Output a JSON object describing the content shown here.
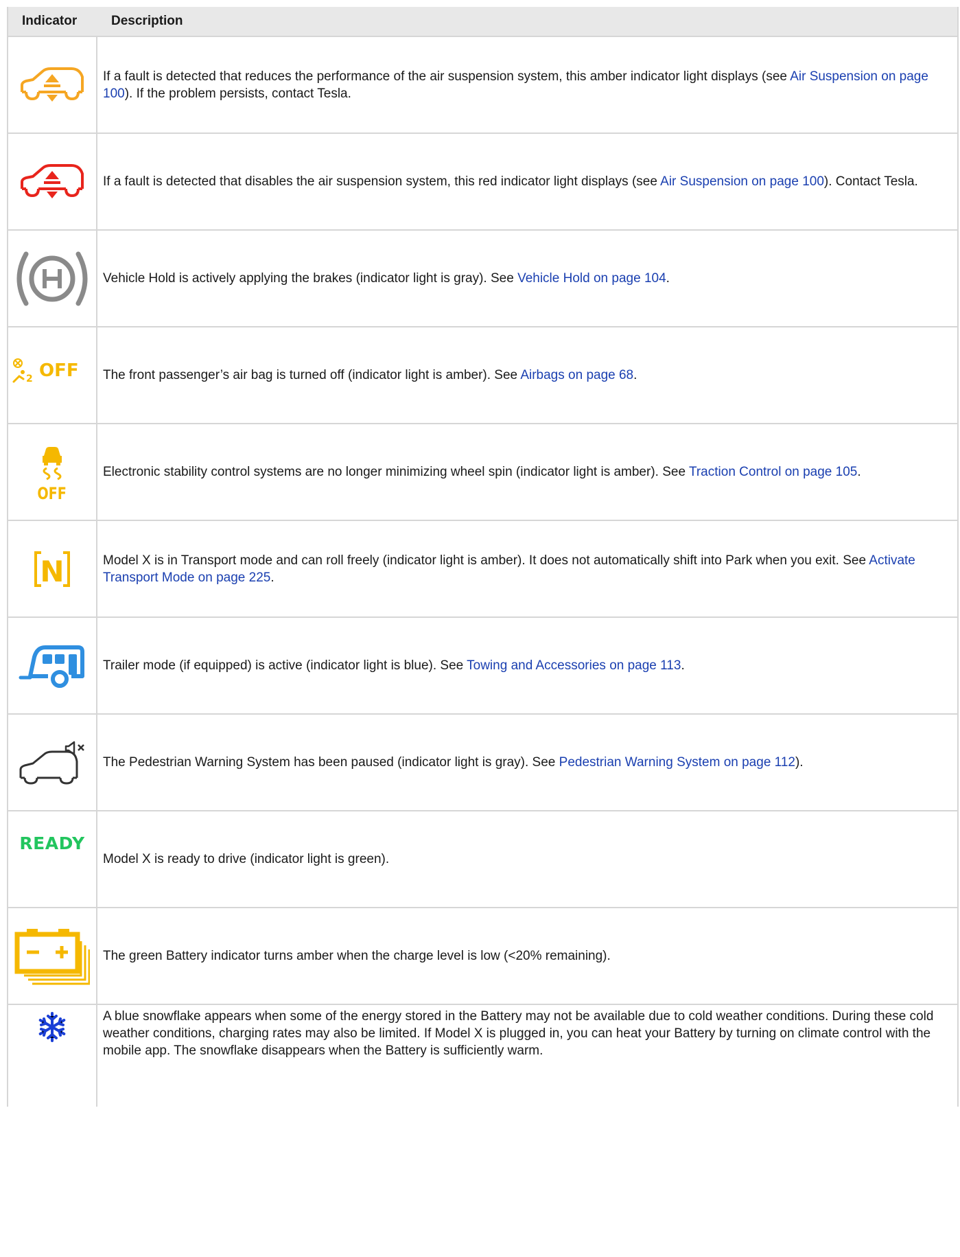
{
  "header": {
    "indicator": "Indicator",
    "description": "Description"
  },
  "rows": [
    {
      "icon": "air-suspension-amber-icon",
      "color": "#f5a623",
      "pre": "If a fault is detected that reduces the performance of the air suspension system, this amber indicator light displays (see ",
      "link": "Air Suspension on page 100",
      "post": "). If the problem persists, contact Tesla."
    },
    {
      "icon": "air-suspension-red-icon",
      "color": "#e8241c",
      "pre": "If a fault is detected that disables the air suspension system, this red indicator light displays (see ",
      "link": "Air Suspension on page 100",
      "post": "). Contact Tesla."
    },
    {
      "icon": "vehicle-hold-icon",
      "color": "#8a8a8a",
      "pre": "Vehicle Hold is actively applying the brakes (indicator light is gray). See ",
      "link": "Vehicle Hold on page 104",
      "post": "."
    },
    {
      "icon": "passenger-airbag-off-icon",
      "color": "#f5b800",
      "icon_text": "OFF",
      "pre": "The front passenger’s air bag is turned off (indicator light is amber). See ",
      "link": "Airbags on page 68",
      "post": "."
    },
    {
      "icon": "traction-control-off-icon",
      "color": "#f5b800",
      "icon_text": "OFF",
      "pre": "Electronic stability control systems are no longer minimizing wheel spin (indicator light is amber). See ",
      "link": "Traction Control on page 105",
      "post": "."
    },
    {
      "icon": "transport-mode-icon",
      "color": "#f5b800",
      "icon_text": "N",
      "pre": "Model X is in Transport mode and can roll freely (indicator light is amber). It does not automatically shift into Park when you exit. See ",
      "link": "Activate Transport Mode on page 225",
      "post": "."
    },
    {
      "icon": "trailer-mode-icon",
      "color": "#2f8fe0",
      "pre": "Trailer mode (if equipped) is active (indicator light is blue). See ",
      "link": "Towing and Accessories on page 113",
      "post": "."
    },
    {
      "icon": "pedestrian-warning-paused-icon",
      "color": "#333333",
      "pre": "The Pedestrian Warning System has been paused (indicator light is gray). See ",
      "link": "Pedestrian Warning System on page 112",
      "post": ")."
    },
    {
      "icon": "ready-icon",
      "color": "#22c55e",
      "icon_text": "READY",
      "pre": "Model X is ready to drive (indicator light is green).",
      "link": "",
      "post": ""
    },
    {
      "icon": "battery-low-icon",
      "color": "#f5b800",
      "pre": "The green Battery indicator turns amber when the charge level is low (<20% remaining).",
      "link": "",
      "post": ""
    },
    {
      "icon": "snowflake-icon",
      "color": "#1a3fd6",
      "pre": "A blue snowflake appears when some of the energy stored in the Battery may not be available due to cold weather conditions. During these cold weather conditions, charging rates may also be limited. If Model X is plugged in, you can heat your Battery by turning on climate control with the mobile app. The snowflake disappears when the Battery is sufficiently warm.",
      "link": "",
      "post": ""
    }
  ]
}
